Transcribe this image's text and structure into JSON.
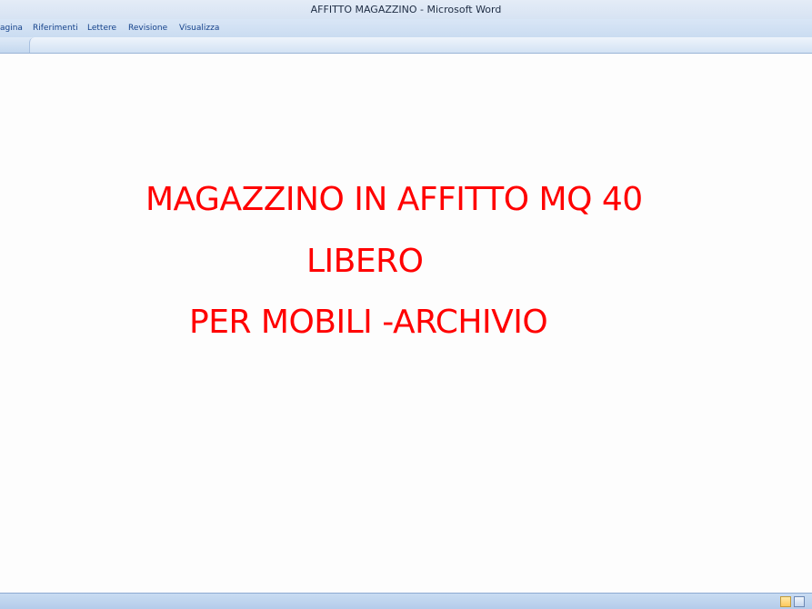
{
  "window": {
    "title": "AFFITTO MAGAZZINO - Microsoft Word"
  },
  "ribbon": {
    "tabs": [
      {
        "label": "agina"
      },
      {
        "label": "Riferimenti"
      },
      {
        "label": "Lettere"
      },
      {
        "label": "Revisione"
      },
      {
        "label": "Visualizza"
      }
    ]
  },
  "document": {
    "lines": [
      "MAGAZZINO IN AFFITTO MQ 40",
      "LIBERO",
      "PER MOBILI -ARCHIVIO"
    ],
    "text_color": "#ff0000"
  },
  "statusbar": {
    "view_buttons": [
      "print-layout",
      "full-screen-reading"
    ]
  }
}
